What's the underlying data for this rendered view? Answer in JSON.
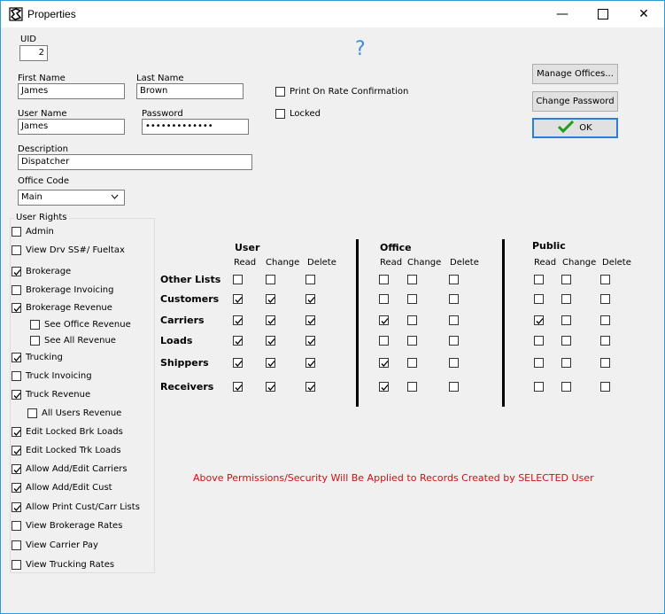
{
  "window": {
    "title": "Properties",
    "minimize_icon": "minimize-icon",
    "maximize_icon": "maximize-icon",
    "close_icon": "close-icon"
  },
  "form": {
    "uid_label": "UID",
    "uid_value": "2",
    "help_symbol": "?",
    "first_name_label": "First Name",
    "first_name_value": "James",
    "last_name_label": "Last Name",
    "last_name_value": "Brown",
    "user_name_label": "User Name",
    "user_name_value": "James",
    "password_label": "Password",
    "password_value": "•••••••••••••",
    "description_label": "Description",
    "description_value": "Dispatcher",
    "office_code_label": "Office Code",
    "office_code_value": "Main",
    "print_on_rate_label": "Print On Rate Confirmation",
    "print_on_rate_checked": false,
    "locked_label": "Locked",
    "locked_checked": false
  },
  "buttons": {
    "manage_offices": "Manage Offices...",
    "change_password": "Change Password",
    "ok": "OK"
  },
  "user_rights": {
    "title": "User Rights",
    "items": [
      {
        "label": "Admin",
        "checked": false,
        "indent": 0
      },
      {
        "label": "View Drv SS#/ Fueltax",
        "checked": false,
        "indent": 0
      },
      {
        "label": "Brokerage",
        "checked": true,
        "indent": 0
      },
      {
        "label": "Brokerage Invoicing",
        "checked": false,
        "indent": 0
      },
      {
        "label": "Brokerage Revenue",
        "checked": true,
        "indent": 0
      },
      {
        "label": "See Office Revenue",
        "checked": false,
        "indent": 1
      },
      {
        "label": "See All Revenue",
        "checked": false,
        "indent": 1
      },
      {
        "label": "Trucking",
        "checked": true,
        "indent": 0
      },
      {
        "label": "Truck Invoicing",
        "checked": false,
        "indent": 0
      },
      {
        "label": "Truck Revenue",
        "checked": true,
        "indent": 0
      },
      {
        "label": "All Users Revenue",
        "checked": false,
        "indent": 1
      },
      {
        "label": "Edit Locked Brk Loads",
        "checked": true,
        "indent": 0
      },
      {
        "label": "Edit Locked Trk Loads",
        "checked": true,
        "indent": 0
      },
      {
        "label": "Allow Add/Edit Carriers",
        "checked": true,
        "indent": 0
      },
      {
        "label": "Allow Add/Edit Cust",
        "checked": true,
        "indent": 0
      },
      {
        "label": "Allow Print Cust/Carr Lists",
        "checked": true,
        "indent": 0
      },
      {
        "label": "View Brokerage Rates",
        "checked": false,
        "indent": 0
      },
      {
        "label": "View Carrier Pay",
        "checked": false,
        "indent": 0
      },
      {
        "label": "View Trucking Rates",
        "checked": false,
        "indent": 0
      }
    ]
  },
  "permissions": {
    "sections": [
      {
        "title": "User",
        "columns": [
          "Read",
          "Change",
          "Delete"
        ]
      },
      {
        "title": "Office",
        "columns": [
          "Read",
          "Change",
          "Delete"
        ]
      },
      {
        "title": "Public",
        "columns": [
          "Read",
          "Change",
          "Delete"
        ]
      }
    ],
    "rows": [
      {
        "label": "Other Lists",
        "values": [
          false,
          false,
          false,
          false,
          false,
          false,
          false,
          false,
          false
        ]
      },
      {
        "label": "Customers",
        "values": [
          true,
          true,
          true,
          false,
          false,
          false,
          false,
          false,
          false
        ]
      },
      {
        "label": "Carriers",
        "values": [
          true,
          true,
          true,
          true,
          false,
          false,
          true,
          false,
          false
        ]
      },
      {
        "label": "Loads",
        "values": [
          true,
          true,
          true,
          false,
          false,
          false,
          false,
          false,
          false
        ]
      },
      {
        "label": "Shippers",
        "values": [
          true,
          true,
          true,
          true,
          false,
          false,
          false,
          false,
          false
        ]
      },
      {
        "label": "Receivers",
        "values": [
          true,
          true,
          true,
          true,
          false,
          false,
          false,
          false,
          false
        ]
      }
    ],
    "note": "Above Permissions/Security Will Be Applied to Records Created by SELECTED User"
  },
  "colors": {
    "accent": "#2e7bd6",
    "warning": "#d01010",
    "help": "#3b8ee0",
    "ok_check": "#1f9e1f"
  }
}
